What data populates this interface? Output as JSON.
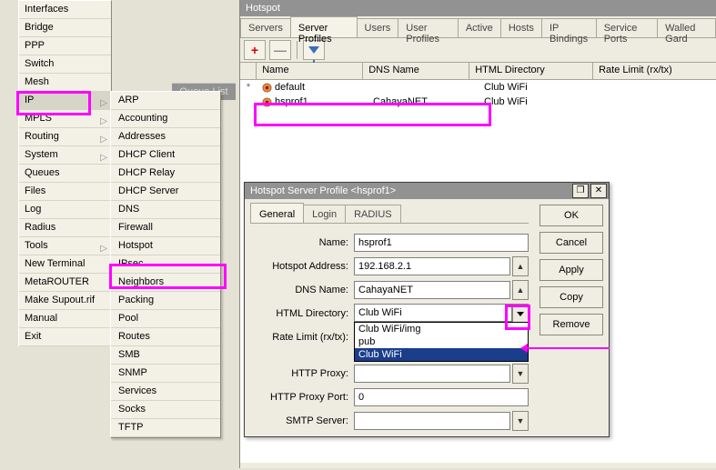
{
  "main_menu": {
    "items": [
      {
        "label": "Interfaces",
        "arrow": false
      },
      {
        "label": "Bridge",
        "arrow": false
      },
      {
        "label": "PPP",
        "arrow": false
      },
      {
        "label": "Switch",
        "arrow": false
      },
      {
        "label": "Mesh",
        "arrow": false
      },
      {
        "label": "IP",
        "arrow": true,
        "selected": true
      },
      {
        "label": "MPLS",
        "arrow": true
      },
      {
        "label": "Routing",
        "arrow": true
      },
      {
        "label": "System",
        "arrow": true
      },
      {
        "label": "Queues",
        "arrow": false
      },
      {
        "label": "Files",
        "arrow": false
      },
      {
        "label": "Log",
        "arrow": false
      },
      {
        "label": "Radius",
        "arrow": false
      },
      {
        "label": "Tools",
        "arrow": true
      },
      {
        "label": "New Terminal",
        "arrow": false
      },
      {
        "label": "MetaROUTER",
        "arrow": false
      },
      {
        "label": "Make Supout.rif",
        "arrow": false
      },
      {
        "label": "Manual",
        "arrow": false
      },
      {
        "label": "Exit",
        "arrow": false
      }
    ]
  },
  "sub_menu": {
    "items": [
      "ARP",
      "Accounting",
      "Addresses",
      "DHCP Client",
      "DHCP Relay",
      "DHCP Server",
      "DNS",
      "Firewall",
      "Hotspot",
      "IPsec",
      "Neighbors",
      "Packing",
      "Pool",
      "Routes",
      "SMB",
      "SNMP",
      "Services",
      "Socks",
      "TFTP"
    ]
  },
  "queue_caption": "Queue List",
  "hotspot": {
    "title": "Hotspot",
    "tabs": [
      "Servers",
      "Server Profiles",
      "Users",
      "User Profiles",
      "Active",
      "Hosts",
      "IP Bindings",
      "Service Ports",
      "Walled Gard"
    ],
    "active_tab": 1,
    "grid": {
      "headers": [
        "",
        "Name",
        "DNS Name",
        "HTML Directory",
        "Rate Limit (rx/tx)"
      ],
      "rows": [
        {
          "flag": "*",
          "name": "default",
          "dns": "",
          "html": "Club WiFi"
        },
        {
          "flag": "",
          "name": "hsprof1",
          "dns": "CahayaNET",
          "html": "Club WiFi"
        }
      ]
    }
  },
  "dialog": {
    "title": "Hotspot Server Profile <hsprof1>",
    "tabs": [
      "General",
      "Login",
      "RADIUS"
    ],
    "active_tab": 0,
    "side_buttons": [
      "OK",
      "Cancel",
      "Apply",
      "Copy",
      "Remove"
    ],
    "fields": {
      "name_label": "Name:",
      "name_value": "hsprof1",
      "addr_label": "Hotspot Address:",
      "addr_value": "192.168.2.1",
      "dns_label": "DNS Name:",
      "dns_value": "CahayaNET",
      "html_label": "HTML Directory:",
      "html_value": "Club WiFi",
      "html_options": [
        "Club WiFi/img",
        "pub",
        "Club WiFi"
      ],
      "html_selected": 2,
      "rate_label": "Rate Limit (rx/tx):",
      "rate_value": "",
      "proxy_label": "HTTP Proxy:",
      "proxy_value": "",
      "proxyport_label": "HTTP Proxy Port:",
      "proxyport_value": "0",
      "smtp_label": "SMTP Server:",
      "smtp_value": ""
    }
  }
}
